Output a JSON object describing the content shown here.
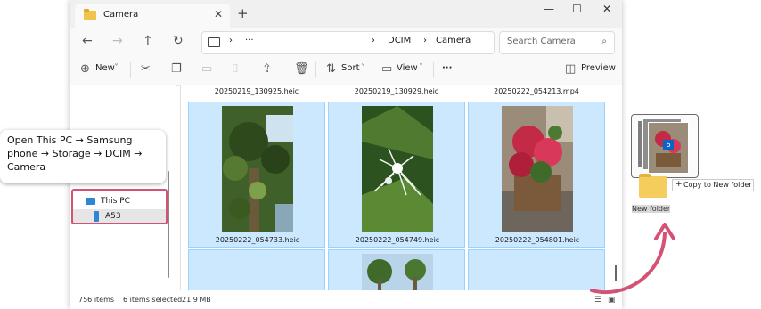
{
  "window": {
    "tab_title": "Camera",
    "tab_close": "✕",
    "new_tab": "+",
    "minimize": "—",
    "maximize": "☐",
    "close": "✕"
  },
  "address": {
    "more": "···",
    "crumbs": [
      "DCIM",
      "Camera"
    ],
    "search_placeholder": "Search Camera"
  },
  "toolbar": {
    "new_label": "New",
    "sort_label": "Sort",
    "view_label": "View",
    "more": "···",
    "preview_label": "Preview"
  },
  "nav_pane": {
    "items": [
      {
        "label": "This PC",
        "icon": "computer-icon"
      },
      {
        "label": "A53",
        "icon": "phone-icon"
      }
    ]
  },
  "files": {
    "top_row_names": [
      "20250219_130925.heic",
      "20250219_130929.heic",
      "20250222_054213.mp4"
    ],
    "middle_row": [
      {
        "name": "20250222_054733.heic",
        "selected": true
      },
      {
        "name": "20250222_054749.heic",
        "selected": true
      },
      {
        "name": "20250222_054801.heic",
        "selected": true
      }
    ]
  },
  "status": {
    "items": "756 items",
    "selected": "6 items selected",
    "size": "21.9 MB"
  },
  "callout": {
    "text": "Open This PC → Samsung phone → Storage → DCIM → Camera"
  },
  "drag": {
    "count": "6",
    "folder_label": "New folder",
    "tooltip": "Copy to New folder",
    "tooltip_symbol": "+"
  },
  "colors": {
    "selection": "#cce8ff",
    "highlight": "#d45273",
    "accent": "#0a64c8"
  }
}
